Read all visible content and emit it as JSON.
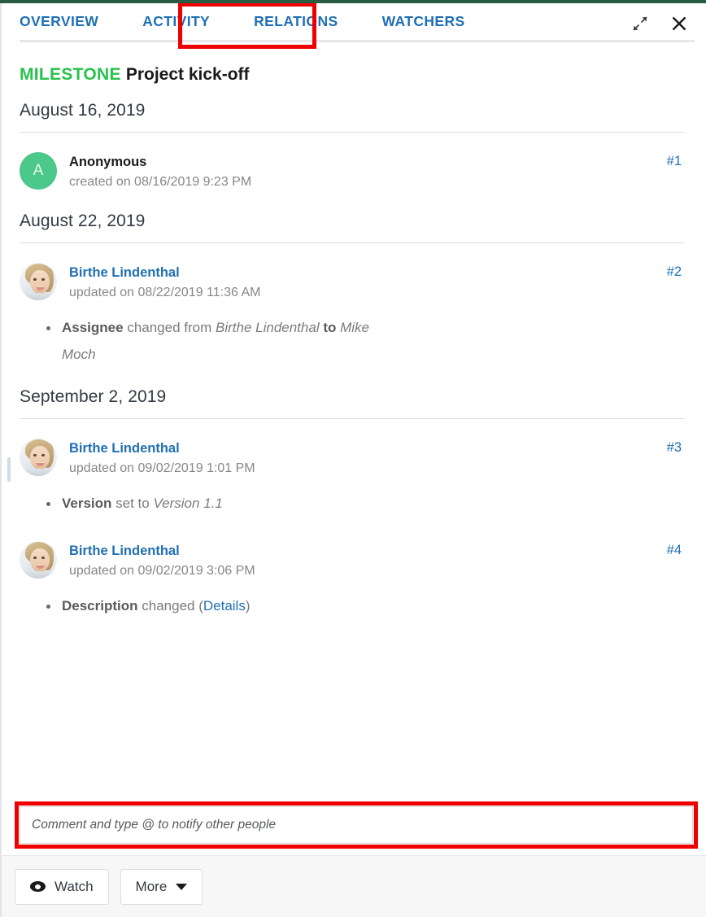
{
  "window": {
    "accent_green": "#2a5c44",
    "annotation_color": "#ee0000",
    "link_color": "#1f6fb5",
    "milestone_color": "#27c24c"
  },
  "tabs": [
    {
      "label": "OVERVIEW",
      "active": false
    },
    {
      "label": "ACTIVITY",
      "active": true
    },
    {
      "label": "RELATIONS",
      "active": false
    },
    {
      "label": "WATCHERS",
      "active": false
    }
  ],
  "tab_actions": {
    "fullscreen_icon": "expand-diagonal-icon",
    "close_icon": "close-icon"
  },
  "work_package": {
    "type": "MILESTONE",
    "subject": "Project kick-off"
  },
  "activity": {
    "groups": [
      {
        "date": "August 16, 2019",
        "entries": [
          {
            "user": "Anonymous",
            "avatar_kind": "initials",
            "avatar_initial": "A",
            "timestamp": "created on 08/16/2019 9:23 PM",
            "anchor": "#1",
            "details": []
          }
        ]
      },
      {
        "date": "August 22, 2019",
        "entries": [
          {
            "user": "Birthe Lindenthal",
            "avatar_kind": "photo",
            "avatar_initial": "",
            "timestamp": "updated on 08/22/2019 11:36 AM",
            "anchor": "#2",
            "details": [
              {
                "parts": [
                  {
                    "text": "Assignee",
                    "style": "bold"
                  },
                  {
                    "text": " changed from ",
                    "style": "plain"
                  },
                  {
                    "text": "Birthe Lindenthal",
                    "style": "italic"
                  },
                  {
                    "text": " to ",
                    "style": "bold"
                  },
                  {
                    "text": "Mike Moch",
                    "style": "italic"
                  }
                ]
              }
            ]
          }
        ]
      },
      {
        "date": "September 2, 2019",
        "entries": [
          {
            "user": "Birthe Lindenthal",
            "avatar_kind": "photo",
            "avatar_initial": "",
            "timestamp": "updated on 09/02/2019 1:01 PM",
            "anchor": "#3",
            "details": [
              {
                "parts": [
                  {
                    "text": "Version",
                    "style": "bold"
                  },
                  {
                    "text": " set to ",
                    "style": "plain"
                  },
                  {
                    "text": "Version 1.1",
                    "style": "italic"
                  }
                ]
              }
            ]
          },
          {
            "user": "Birthe Lindenthal",
            "avatar_kind": "photo",
            "avatar_initial": "",
            "timestamp": "updated on 09/02/2019 3:06 PM",
            "anchor": "#4",
            "details": [
              {
                "parts": [
                  {
                    "text": "Description",
                    "style": "bold"
                  },
                  {
                    "text": " changed (",
                    "style": "plain"
                  },
                  {
                    "text": "Details",
                    "style": "link"
                  },
                  {
                    "text": ")",
                    "style": "plain"
                  }
                ]
              }
            ]
          }
        ]
      }
    ]
  },
  "comment": {
    "value": "",
    "placeholder": "Comment and type @ to notify other people"
  },
  "footer": {
    "watch_label": "Watch",
    "more_label": "More"
  }
}
